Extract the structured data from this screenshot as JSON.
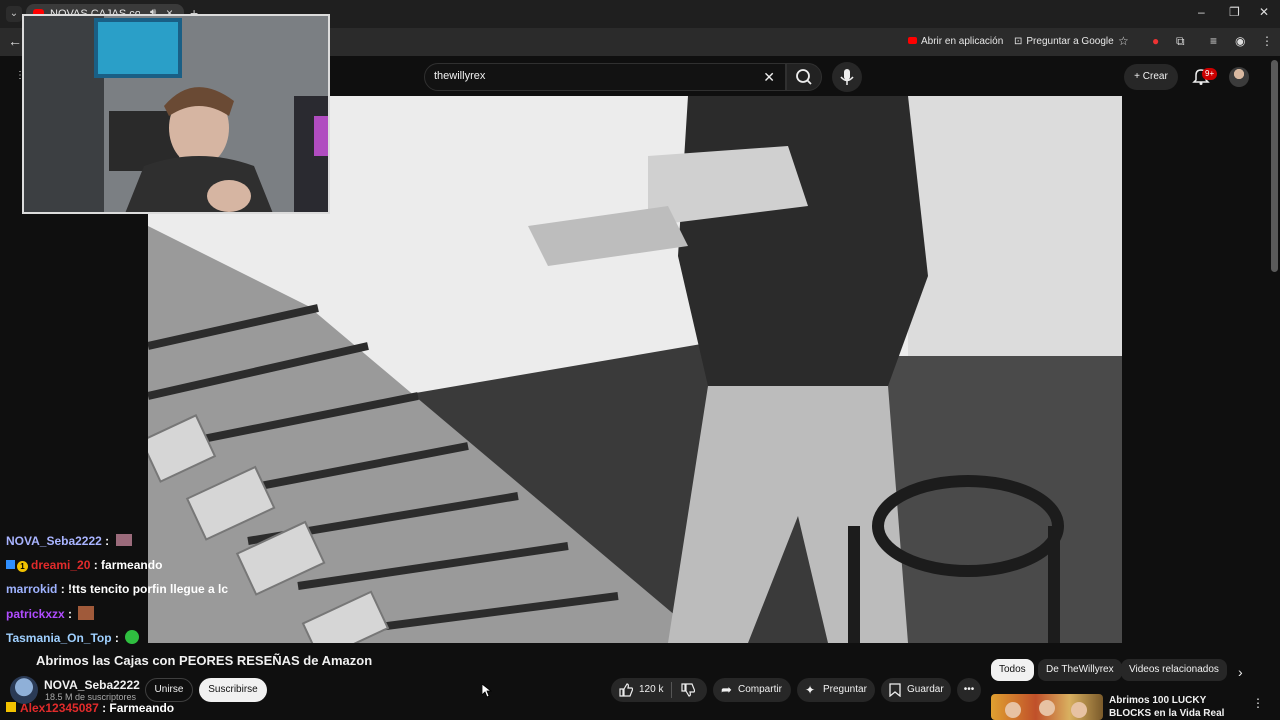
{
  "browser": {
    "tab_title": "NOVAS CAJAS con",
    "addr_actions": {
      "open_app": "Abrir en aplicación",
      "ask_google": "Preguntar a Google"
    }
  },
  "header": {
    "search_value": "thewillyrex",
    "create_label": "Crear",
    "notif_badge": "9+"
  },
  "chat": {
    "lines": [
      {
        "user": "NOVA_Seba2222",
        "sep": " :",
        "msg": "",
        "user_color": "#a9b4ff"
      },
      {
        "user": "dreami_20",
        "sep": " : ",
        "msg": "farmeando",
        "user_color": "#e22b2b",
        "badge": "1"
      },
      {
        "user": "marrokid",
        "sep": " : ",
        "msg": "!tts tencito porfin llegue a lc",
        "user_color": "#9fb3ff"
      },
      {
        "user": "patrickxzx",
        "sep": " :",
        "msg": "",
        "user_color": "#b04cff"
      },
      {
        "user": "Tasmania_On_Top",
        "sep": " :",
        "msg": "",
        "user_color": "#9fd0ff"
      },
      {
        "user": "Alex12345087",
        "sep": " : ",
        "msg": "Farmeando",
        "user_color": "#e22b2b"
      }
    ]
  },
  "video": {
    "title": "Abrimos las Cajas con PEORES RESEÑAS de Amazon",
    "channel": "NOVA_Seba2222",
    "subscribers": "18.5 M de suscriptores",
    "join_label": "Unirse",
    "subscribe_label": "Suscribirse",
    "likes": "120 k",
    "share_label": "Compartir",
    "ask_label": "Preguntar",
    "save_label": "Guardar"
  },
  "sidebar": {
    "chips": [
      "Todos",
      "De TheWillyrex",
      "Videos relacionados"
    ],
    "rec_title": "Abrimos 100 LUCKY BLOCKS en la Vida Real"
  }
}
